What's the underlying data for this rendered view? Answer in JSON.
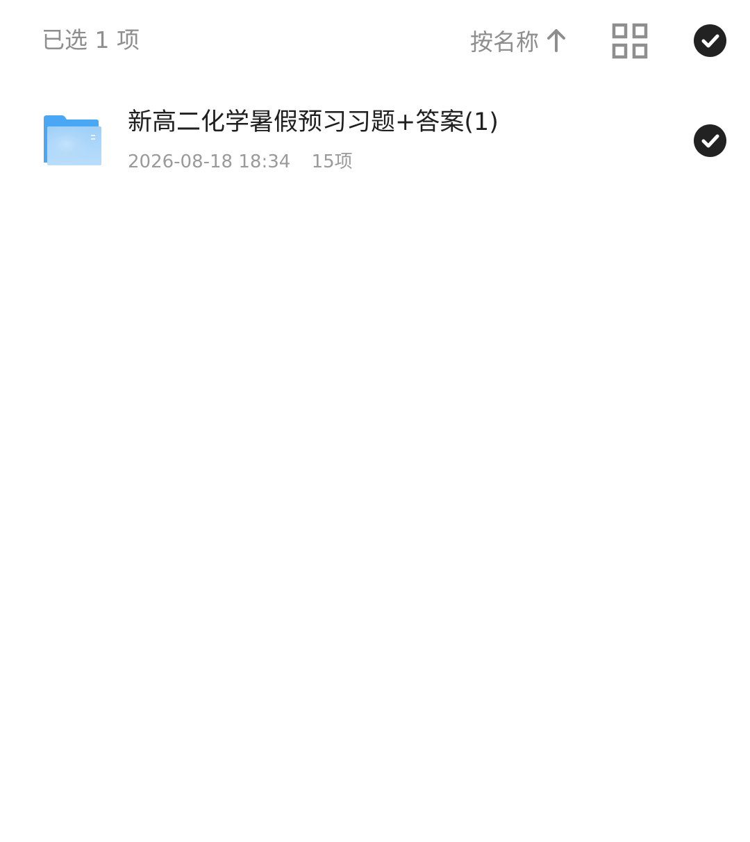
{
  "header": {
    "selected_text": "已选 1 项",
    "sort_label": "按名称",
    "sort_direction": "ascending",
    "sort_icon": "arrow-up-icon",
    "view_toggle_icon": "grid-view-icon",
    "select_all_icon": "check-circle-icon",
    "select_all_checked": true
  },
  "files": [
    {
      "name": "新高二化学暑假预习习题+答案(1)",
      "modified": "2026-08-18 18:34",
      "count": "15项",
      "icon": "folder-icon",
      "selected": true
    }
  ],
  "colors": {
    "primary_text": "#1f1f1f",
    "secondary_text": "#9a9a9a",
    "header_text": "#8e8e8e",
    "check_fill": "#222222",
    "folder_blue": "#4aa7f4"
  }
}
